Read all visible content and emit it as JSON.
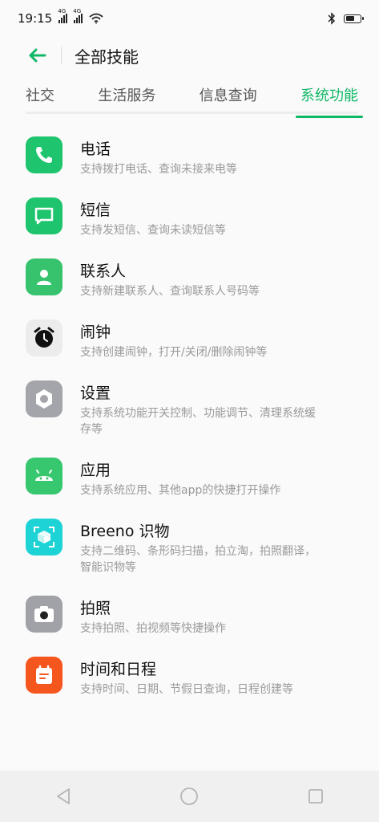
{
  "status": {
    "time": "19:15",
    "sig1_tag": "4G",
    "sig2_tag": "4G",
    "battery_pct": 70
  },
  "header": {
    "title": "全部技能"
  },
  "tabs": [
    {
      "label": "社交",
      "active": false
    },
    {
      "label": "生活服务",
      "active": false
    },
    {
      "label": "信息查询",
      "active": false
    },
    {
      "label": "系统功能",
      "active": true
    }
  ],
  "items": [
    {
      "icon": "phone-icon",
      "color": "#1fc56e",
      "title": "电话",
      "sub": "支持拨打电话、查询未接来电等"
    },
    {
      "icon": "message-icon",
      "color": "#1fc56e",
      "title": "短信",
      "sub": "支持发短信、查询未读短信等"
    },
    {
      "icon": "contact-icon",
      "color": "#37c26e",
      "title": "联系人",
      "sub": "支持新建联系人、查询联系人号码等"
    },
    {
      "icon": "alarm-clock-icon",
      "color": "#ececec",
      "title": "闹钟",
      "sub": "支持创建闹钟，打开/关闭/删除闹钟等"
    },
    {
      "icon": "settings-icon",
      "color": "#a3a5ab",
      "title": "设置",
      "sub": "支持系统功能开关控制、功能调节、清理系统缓",
      "sub2": "存等"
    },
    {
      "icon": "android-icon",
      "color": "#37c76e",
      "title": "应用",
      "sub": "支持系统应用、其他app的快捷打开操作"
    },
    {
      "icon": "scan-cube-icon",
      "color": "#1ed3d6",
      "title": "Breeno 识物",
      "sub": "支持二维码、条形码扫描，拍立淘，拍照翻译，",
      "sub2": "智能识物等"
    },
    {
      "icon": "camera-icon",
      "color": "#a0a2a8",
      "title": "拍照",
      "sub": "支持拍照、拍视频等快捷操作"
    },
    {
      "icon": "calendar-icon",
      "color": "#f4561e",
      "title": "时间和日程",
      "sub": "支持时间、日期、节假日查询，日程创建等"
    }
  ],
  "nav": {
    "back": "back-triangle-icon",
    "home": "home-circle-icon",
    "recent": "recent-square-icon"
  }
}
